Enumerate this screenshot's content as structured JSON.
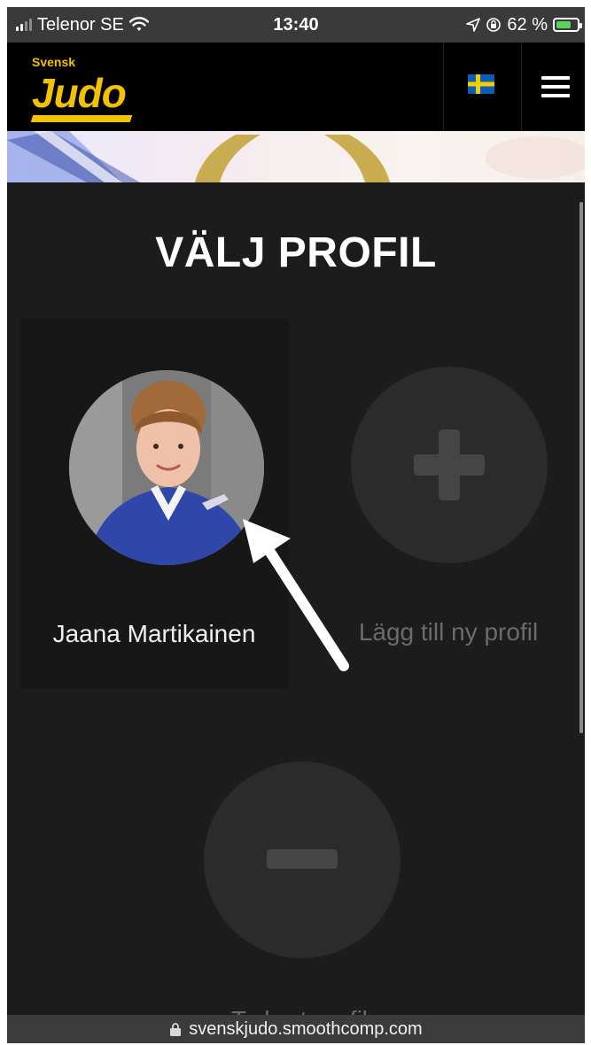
{
  "status_bar": {
    "carrier": "Telenor SE",
    "time": "13:40",
    "battery": "62 %",
    "battery_level": 0.62,
    "icons": [
      "signal-icon",
      "wifi-icon",
      "location-icon",
      "orientation-lock-icon",
      "battery-charging-icon"
    ]
  },
  "header": {
    "logo_top": "Svensk",
    "logo_main": "Judo",
    "flag_icon": "sweden-flag-icon",
    "menu_icon": "hamburger-menu-icon"
  },
  "page": {
    "title": "VÄLJ PROFIL"
  },
  "profiles": [
    {
      "name": "Jaana Martikainen"
    }
  ],
  "actions": {
    "add_profile_label": "Lägg till ny profil",
    "remove_profile_label": "Ta bort profil"
  },
  "url_bar": {
    "url": "svenskjudo.smoothcomp.com"
  },
  "colors": {
    "background": "#1c1c1d",
    "accent_yellow": "#f2c200",
    "card": "#171718",
    "circle": "#2b2b2c"
  }
}
